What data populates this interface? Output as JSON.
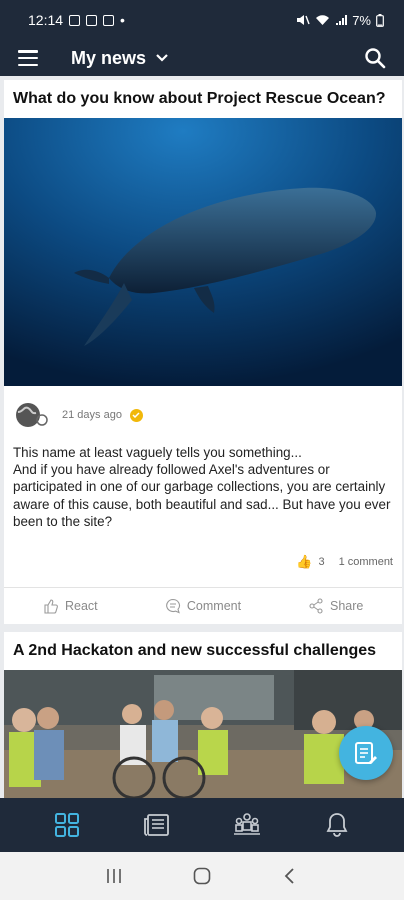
{
  "status": {
    "time": "12:14",
    "dot": "•",
    "battery": "7%"
  },
  "app_bar": {
    "title": "My news"
  },
  "feed": {
    "posts": [
      {
        "title": "What do you know about Project Rescue Ocean?",
        "image": "humpback-whale-underwater-photo",
        "age": "21 days ago",
        "body": "This name at least vaguely tells you something...\nAnd if you have already followed Axel's adventures or participated in one of our garbage collections, you are certainly aware of this cause, both beautiful and sad... But have you ever been to the site?",
        "reactions_count": "3",
        "comments": "1 comment",
        "actions": {
          "react": "React",
          "comment": "Comment",
          "share": "Share"
        }
      },
      {
        "title": "A 2nd Hackaton and new successful challenges",
        "image": "group-people-wheelchair-activity-photo"
      }
    ]
  },
  "colors": {
    "bar_bg": "#1f2a3a",
    "accent": "#43b4e0",
    "verified": "#f1b80a",
    "page_bg": "#e9ebee"
  },
  "bottom_nav": {
    "items": [
      "dashboard-icon",
      "news-icon",
      "community-icon",
      "notifications-icon"
    ],
    "active": "dashboard-icon"
  }
}
